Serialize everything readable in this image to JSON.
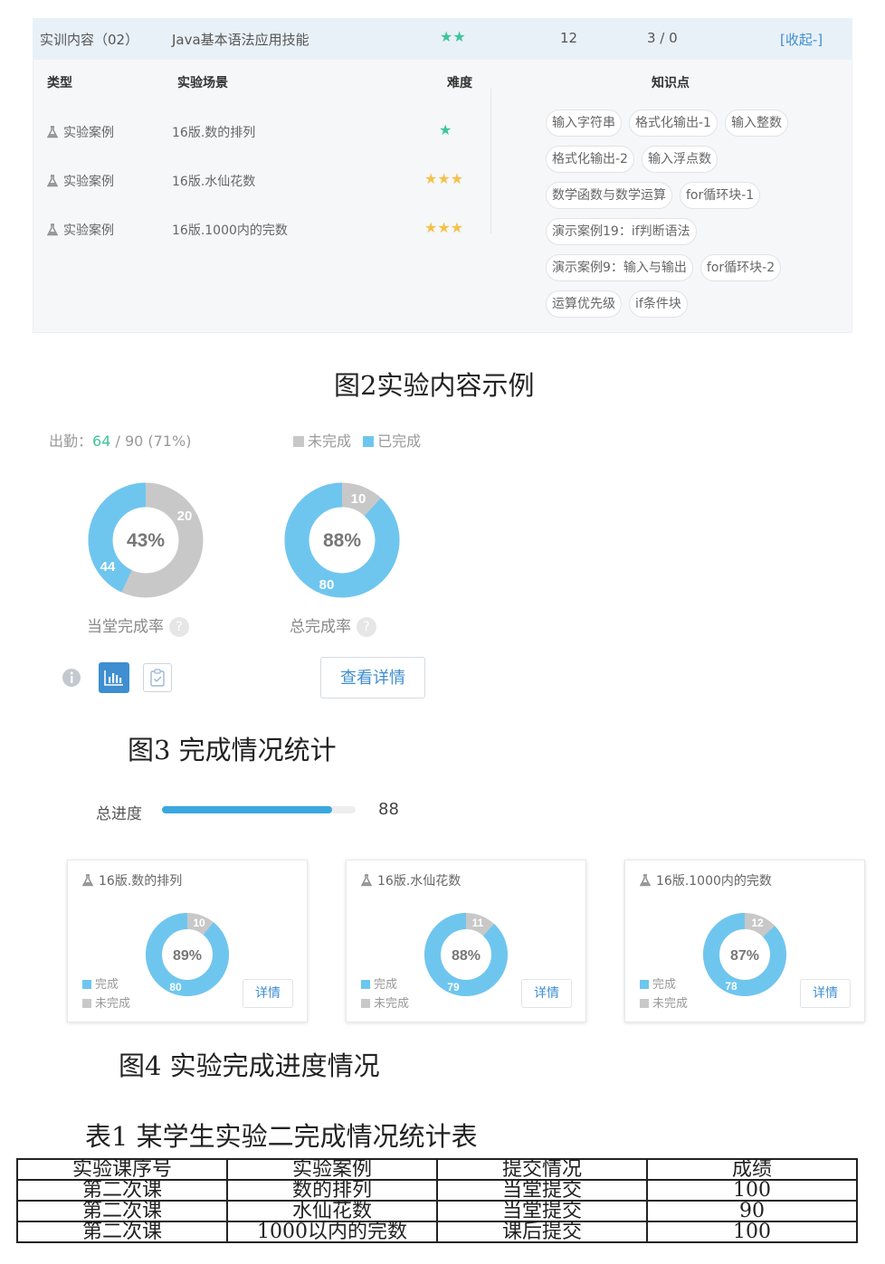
{
  "fig2": {
    "header": {
      "title": "实训内容（02）",
      "course": "Java基本语法应用技能",
      "stars": "★★",
      "count": "12",
      "ratio": "3 / 0",
      "collapse": "[收起-]"
    },
    "columns": {
      "type": "类型",
      "scene": "实验场景",
      "difficulty": "难度",
      "knowledge": "知识点"
    },
    "rows": [
      {
        "type": "实验案例",
        "name": "16版.数的排列",
        "stars": "★",
        "color": "#3fc59a"
      },
      {
        "type": "实验案例",
        "name": "16版.水仙花数",
        "stars": "★★★",
        "color": "#f4c14a"
      },
      {
        "type": "实验案例",
        "name": "16版.1000内的完数",
        "stars": "★★★",
        "color": "#f4c14a"
      }
    ],
    "tags": [
      "输入字符串",
      "格式化输出-1",
      "输入整数",
      "格式化输出-2",
      "输入浮点数",
      "数学函数与数学运算",
      "for循环块-1",
      "演示案例19：if判断语法",
      "演示案例9：输入与输出",
      "for循环块-2",
      "运算优先级",
      "if条件块"
    ]
  },
  "caption2": "图2实验内容示例",
  "fig3": {
    "attendance_label": "出勤：",
    "attendance_present": "64",
    "attendance_rest": " / 90 (71%)",
    "legend_incomplete": "未完成",
    "legend_complete": "已完成",
    "donut1": {
      "pct": "43%",
      "incomplete": "20",
      "complete": "44",
      "label": "当堂完成率",
      "fraction": 0.43
    },
    "donut2": {
      "pct": "88%",
      "incomplete": "10",
      "complete": "80",
      "label": "总完成率",
      "fraction": 0.88
    },
    "help": "?",
    "detail_button": "查看详情",
    "colors": {
      "complete": "#6ec6ef",
      "incomplete": "#c8c8c8"
    }
  },
  "caption3": "图3 完成情况统计",
  "fig4": {
    "progress_label": "总进度",
    "progress_value": "88",
    "progress_fraction": 0.88,
    "cards": [
      {
        "title": "16版.数的排列",
        "pct": "89%",
        "incomplete": "10",
        "complete": "80",
        "fraction": 0.89,
        "leg_complete": "完成",
        "leg_incomplete": "未完成",
        "button": "详情"
      },
      {
        "title": "16版.水仙花数",
        "pct": "88%",
        "incomplete": "11",
        "complete": "79",
        "fraction": 0.88,
        "leg_complete": "完成",
        "leg_incomplete": "未完成",
        "button": "详情"
      },
      {
        "title": "16版.1000内的完数",
        "pct": "87%",
        "incomplete": "12",
        "complete": "78",
        "fraction": 0.87,
        "leg_complete": "完成",
        "leg_incomplete": "未完成",
        "button": "详情"
      }
    ]
  },
  "caption4": "图4 实验完成进度情况",
  "table1": {
    "caption": "表1 某学生实验二完成情况统计表",
    "headers": [
      "实验课序号",
      "实验案例",
      "提交情况",
      "成绩"
    ],
    "rows": [
      [
        "第二次课",
        "数的排列",
        "当堂提交",
        "100"
      ],
      [
        "第二次课",
        "水仙花数",
        "当堂提交",
        "90"
      ],
      [
        "第二次课",
        "1000以内的完数",
        "课后提交",
        "100"
      ]
    ]
  }
}
